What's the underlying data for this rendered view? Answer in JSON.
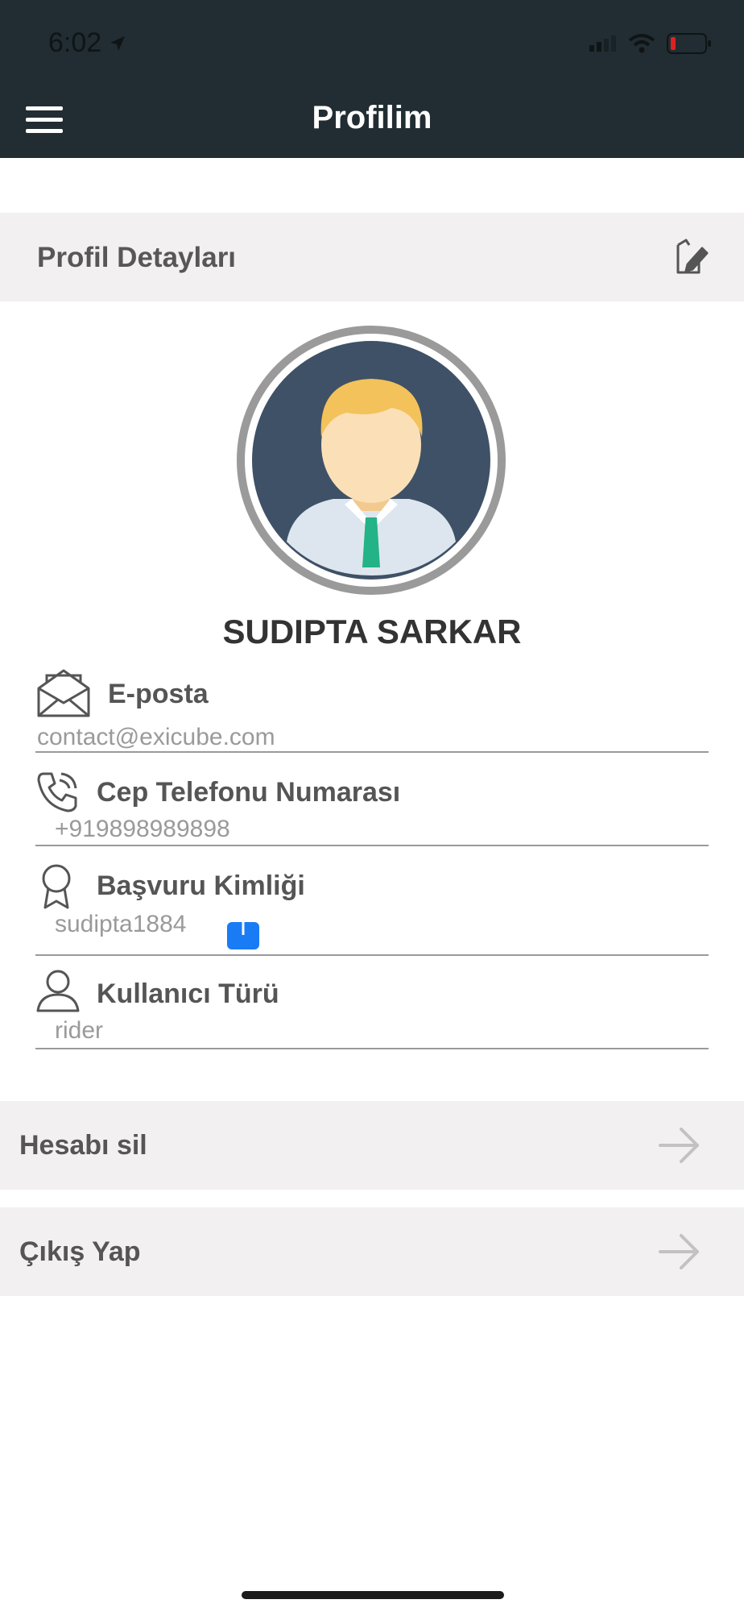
{
  "status_bar": {
    "time": "6:02"
  },
  "header": {
    "title": "Profilim"
  },
  "profile_section": {
    "label": "Profil Detayları"
  },
  "user": {
    "name": "SUDIPTA SARKAR"
  },
  "fields": {
    "email": {
      "label": "E-posta",
      "value": "contact@exicube.com"
    },
    "phone": {
      "label": "Cep Telefonu Numarası",
      "value": "+919898989898"
    },
    "application_id": {
      "label": "Başvuru Kimliği",
      "value": "sudipta1884"
    },
    "user_type": {
      "label": "Kullanıcı Türü",
      "value": "rider"
    }
  },
  "actions": {
    "delete_account": "Hesabı sil",
    "logout": "Çıkış Yap"
  },
  "colors": {
    "header_bg": "#212d32",
    "section_bg": "#f2f0f0",
    "share_blue": "#1a7cf5",
    "tie_green": "#23b386"
  }
}
